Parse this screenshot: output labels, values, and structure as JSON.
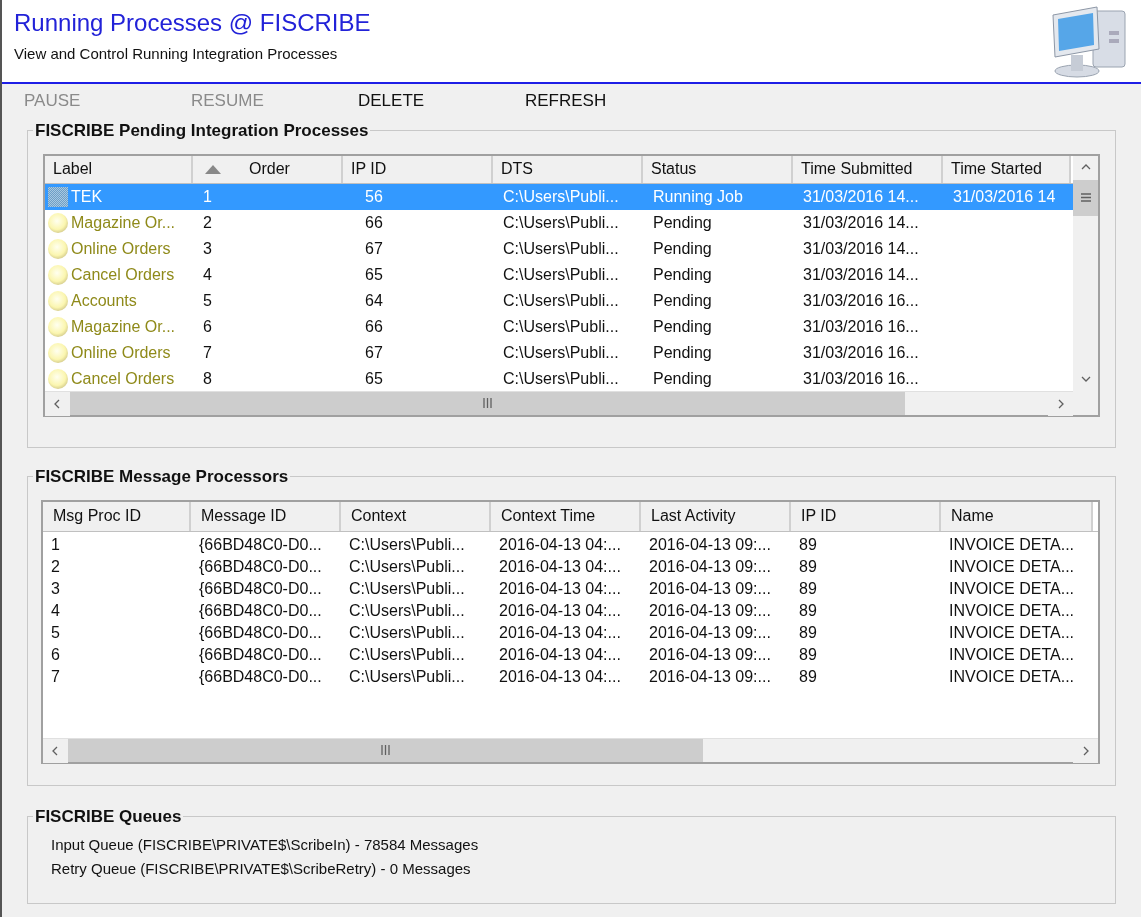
{
  "header": {
    "title": "Running Processes @ FISCRIBE",
    "subtitle": "View and Control Running Integration Processes"
  },
  "toolbar": [
    {
      "label": "PAUSE",
      "disabled": true
    },
    {
      "label": "RESUME",
      "disabled": true
    },
    {
      "label": "DELETE",
      "disabled": false
    },
    {
      "label": "REFRESH",
      "disabled": false
    }
  ],
  "pending": {
    "title": "FISCRIBE Pending Integration Processes",
    "columns": [
      {
        "label": "Label",
        "sorted": false
      },
      {
        "label": "Order",
        "sorted": true
      },
      {
        "label": "IP ID",
        "sorted": false
      },
      {
        "label": "DTS",
        "sorted": false
      },
      {
        "label": "Status",
        "sorted": false
      },
      {
        "label": "Time Submitted",
        "sorted": false
      },
      {
        "label": "Time Started",
        "sorted": false
      }
    ],
    "rows": [
      {
        "kind": "running",
        "selected": true,
        "cells": [
          "TEK",
          "1",
          "56",
          "C:\\Users\\Publi...",
          "Running Job",
          "31/03/2016 14...",
          "31/03/2016 14"
        ]
      },
      {
        "kind": "pending",
        "selected": false,
        "cells": [
          "Magazine Or...",
          "2",
          "66",
          "C:\\Users\\Publi...",
          "Pending",
          "31/03/2016 14..."
        ]
      },
      {
        "kind": "pending",
        "selected": false,
        "cells": [
          "Online Orders",
          "3",
          "67",
          "C:\\Users\\Publi...",
          "Pending",
          "31/03/2016 14..."
        ]
      },
      {
        "kind": "pending",
        "selected": false,
        "cells": [
          "Cancel Orders",
          "4",
          "65",
          "C:\\Users\\Publi...",
          "Pending",
          "31/03/2016 14..."
        ]
      },
      {
        "kind": "pending",
        "selected": false,
        "cells": [
          "Accounts",
          "5",
          "64",
          "C:\\Users\\Publi...",
          "Pending",
          "31/03/2016 16..."
        ]
      },
      {
        "kind": "pending",
        "selected": false,
        "cells": [
          "Magazine Or...",
          "6",
          "66",
          "C:\\Users\\Publi...",
          "Pending",
          "31/03/2016 16..."
        ]
      },
      {
        "kind": "pending",
        "selected": false,
        "cells": [
          "Online Orders",
          "7",
          "67",
          "C:\\Users\\Publi...",
          "Pending",
          "31/03/2016 16..."
        ]
      },
      {
        "kind": "pending",
        "selected": false,
        "cells": [
          "Cancel Orders",
          "8",
          "65",
          "C:\\Users\\Publi...",
          "Pending",
          "31/03/2016 16..."
        ]
      }
    ]
  },
  "processors": {
    "title": "FISCRIBE Message Processors",
    "columns": [
      "Msg Proc ID",
      "Message ID",
      "Context",
      "Context Time",
      "Last Activity",
      "IP ID",
      "Name"
    ],
    "rows": [
      [
        "1",
        "{66BD48C0-D0...",
        "C:\\Users\\Publi...",
        "2016-04-13 04:...",
        "2016-04-13 09:...",
        "89",
        "INVOICE DETA..."
      ],
      [
        "2",
        "{66BD48C0-D0...",
        "C:\\Users\\Publi...",
        "2016-04-13 04:...",
        "2016-04-13 09:...",
        "89",
        "INVOICE DETA..."
      ],
      [
        "3",
        "{66BD48C0-D0...",
        "C:\\Users\\Publi...",
        "2016-04-13 04:...",
        "2016-04-13 09:...",
        "89",
        "INVOICE DETA..."
      ],
      [
        "4",
        "{66BD48C0-D0...",
        "C:\\Users\\Publi...",
        "2016-04-13 04:...",
        "2016-04-13 09:...",
        "89",
        "INVOICE DETA..."
      ],
      [
        "5",
        "{66BD48C0-D0...",
        "C:\\Users\\Publi...",
        "2016-04-13 04:...",
        "2016-04-13 09:...",
        "89",
        "INVOICE DETA..."
      ],
      [
        "6",
        "{66BD48C0-D0...",
        "C:\\Users\\Publi...",
        "2016-04-13 04:...",
        "2016-04-13 09:...",
        "89",
        "INVOICE DETA..."
      ],
      [
        "7",
        "{66BD48C0-D0...",
        "C:\\Users\\Publi...",
        "2016-04-13 04:...",
        "2016-04-13 09:...",
        "89",
        "INVOICE DETA..."
      ]
    ]
  },
  "queues": {
    "title": "FISCRIBE Queues",
    "lines": [
      "Input Queue (FISCRIBE\\PRIVATE$\\ScribeIn) - 78584 Messages",
      "Retry Queue (FISCRIBE\\PRIVATE$\\ScribeRetry) - 0 Messages"
    ]
  }
}
